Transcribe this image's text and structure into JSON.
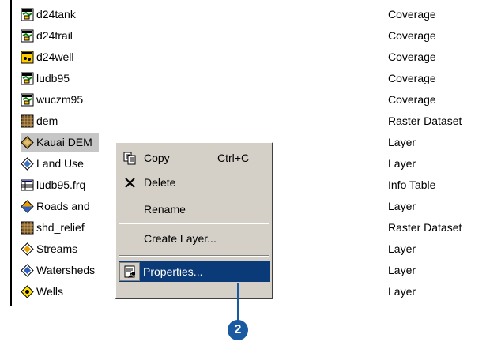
{
  "catalog": {
    "items": [
      {
        "name": "d24tank",
        "type": "Coverage",
        "icon": "coverage-icon"
      },
      {
        "name": "d24trail",
        "type": "Coverage",
        "icon": "coverage-icon"
      },
      {
        "name": "d24well",
        "type": "Coverage",
        "icon": "coverage-icon"
      },
      {
        "name": "ludb95",
        "type": "Coverage",
        "icon": "coverage-icon"
      },
      {
        "name": "wuczm95",
        "type": "Coverage",
        "icon": "coverage-icon"
      },
      {
        "name": "dem",
        "type": "Raster Dataset",
        "icon": "raster-icon"
      },
      {
        "name": "Kauai DEM",
        "type": "Layer",
        "icon": "layer-icon"
      },
      {
        "name": "Land Use",
        "type": "Layer",
        "icon": "layer-icon"
      },
      {
        "name": "ludb95.frq",
        "type": "Info Table",
        "icon": "table-icon"
      },
      {
        "name": "Roads and",
        "type": "Layer",
        "icon": "layer-icon"
      },
      {
        "name": "shd_relief",
        "type": "Raster Dataset",
        "icon": "raster-icon"
      },
      {
        "name": "Streams",
        "type": "Layer",
        "icon": "layer-icon"
      },
      {
        "name": "Watersheds",
        "type": "Layer",
        "icon": "layer-icon"
      },
      {
        "name": "Wells",
        "type": "Layer",
        "icon": "layer-icon"
      }
    ]
  },
  "context_menu": {
    "copy": {
      "label": "Copy",
      "shortcut": "Ctrl+C",
      "icon": "copy-icon"
    },
    "delete": {
      "label": "Delete",
      "icon": "delete-icon"
    },
    "rename": {
      "label": "Rename"
    },
    "create_layer": {
      "label": "Create Layer..."
    },
    "properties": {
      "label": "Properties...",
      "icon": "properties-icon"
    }
  },
  "callout": {
    "number": "2"
  },
  "colors": {
    "highlight": "#0a3a78",
    "menu_bg": "#d4d0c8",
    "callout": "#1a5aa0",
    "selection": "#c6c6c6"
  }
}
